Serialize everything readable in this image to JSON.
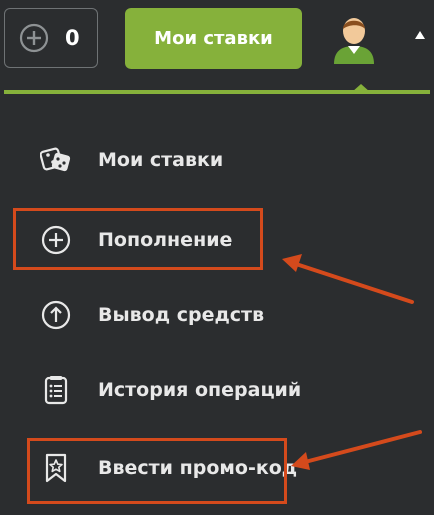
{
  "header": {
    "balance_value": "0",
    "my_bets_button": "Мои ставки"
  },
  "menu": {
    "items": [
      {
        "label": "Мои ставки",
        "icon": "dice-icon"
      },
      {
        "label": "Пополнение",
        "icon": "plus-circle-icon"
      },
      {
        "label": "Вывод средств",
        "icon": "arrow-up-circle-icon"
      },
      {
        "label": "История операций",
        "icon": "list-icon"
      },
      {
        "label": "Ввести промо-код",
        "icon": "bookmark-star-icon"
      }
    ]
  },
  "colors": {
    "background": "#2b2d2f",
    "accent_green": "#86b13b",
    "highlight_orange": "#d44a1c",
    "text": "#e8e8e8"
  }
}
